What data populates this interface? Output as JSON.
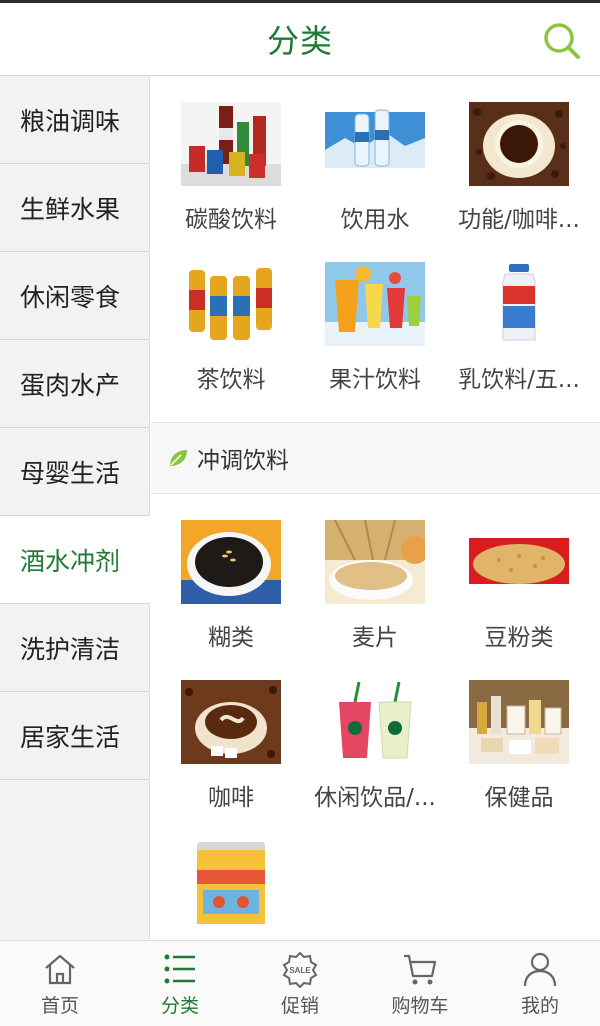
{
  "header": {
    "title": "分类",
    "search_icon": "search-icon"
  },
  "sidebar": {
    "items": [
      {
        "label": "粮油调味"
      },
      {
        "label": "生鲜水果"
      },
      {
        "label": "休闲零食"
      },
      {
        "label": "蛋肉水产"
      },
      {
        "label": "母婴生活"
      },
      {
        "label": "酒水冲剂",
        "active": true
      },
      {
        "label": "洗护清洁"
      },
      {
        "label": "居家生活"
      }
    ]
  },
  "main": {
    "group1": [
      {
        "label": "碳酸饮料",
        "icon": "soda-cans-image"
      },
      {
        "label": "饮用水",
        "icon": "water-bottles-image"
      },
      {
        "label": "功能/咖啡...",
        "icon": "coffee-cup-image"
      },
      {
        "label": "茶饮料",
        "icon": "tea-bottles-image"
      },
      {
        "label": "果汁饮料",
        "icon": "juice-glasses-image"
      },
      {
        "label": "乳饮料/五...",
        "icon": "milk-drink-image"
      }
    ],
    "section": {
      "title": "冲调饮料",
      "icon": "leaf-icon"
    },
    "group2": [
      {
        "label": "糊类",
        "icon": "paste-bowl-image"
      },
      {
        "label": "麦片",
        "icon": "oatmeal-image"
      },
      {
        "label": "豆粉类",
        "icon": "bean-powder-image"
      },
      {
        "label": "咖啡",
        "icon": "coffee-image"
      },
      {
        "label": "休闲饮品/...",
        "icon": "iced-drinks-image"
      },
      {
        "label": "保健品",
        "icon": "health-products-image"
      },
      {
        "label": "",
        "icon": "milk-powder-can-image"
      }
    ]
  },
  "tabbar": {
    "items": [
      {
        "label": "首页",
        "icon": "home-icon"
      },
      {
        "label": "分类",
        "icon": "list-icon",
        "active": true
      },
      {
        "label": "促销",
        "icon": "sale-icon"
      },
      {
        "label": "购物车",
        "icon": "cart-icon"
      },
      {
        "label": "我的",
        "icon": "user-icon"
      }
    ]
  },
  "colors": {
    "accent": "#1f7a34",
    "icon_green": "#8cc63f",
    "sidebar_bg": "#f2f2f2"
  }
}
